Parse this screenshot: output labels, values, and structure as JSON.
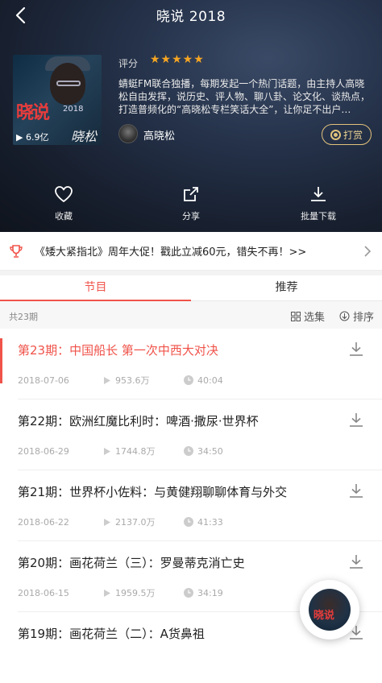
{
  "header": {
    "title": "晓说 2018",
    "cover": {
      "brand": "晓说",
      "year": "2018",
      "plays": "▶ 6.9亿",
      "signature": "晓松"
    },
    "rating_label": "评分",
    "stars": "★★★★★",
    "description": "蜻蜓FM联合独播，每期发起一个热门话题，由主持人高晓松自由发挥，说历史、评人物、聊八卦、论文化、谈热点，打造普频化的“高晓松专栏笑话大全”，让你足不出户…",
    "host_name": "高晓松",
    "reward_label": "打赏",
    "actions": [
      {
        "label": "收藏",
        "icon": "heart-icon"
      },
      {
        "label": "分享",
        "icon": "share-icon"
      },
      {
        "label": "批量下载",
        "icon": "download-icon"
      }
    ]
  },
  "promo": {
    "text": "《矮大紧指北》周年大促！戳此立减60元，错失不再！>>"
  },
  "tabs": [
    {
      "label": "节目",
      "active": true
    },
    {
      "label": "推荐",
      "active": false
    }
  ],
  "list": {
    "count": "共23期",
    "select_label": "选集",
    "sort_label": "排序"
  },
  "episodes": [
    {
      "title": "第23期：中国船长 第一次中西大对决",
      "date": "2018-07-06",
      "plays": "953.6万",
      "duration": "40:04",
      "active": true
    },
    {
      "title": "第22期：欧洲红魔比利时：啤酒·撒尿·世界杯",
      "date": "2018-06-29",
      "plays": "1744.8万",
      "duration": "34:50",
      "active": false
    },
    {
      "title": "第21期：世界杯小佐料：与黄健翔聊聊体育与外交",
      "date": "2018-06-22",
      "plays": "2137.0万",
      "duration": "41:33",
      "active": false
    },
    {
      "title": "第20期：画花荷兰（三）：罗曼蒂克消亡史",
      "date": "2018-06-15",
      "plays": "1959.5万",
      "duration": "34:19",
      "active": false
    },
    {
      "title": "第19期：画花荷兰（二）：A货鼻祖",
      "date": "",
      "plays": "",
      "duration": "",
      "active": false
    }
  ],
  "colors": {
    "accent": "#f0534a",
    "gold": "#e2c27c",
    "header_bg": "#1c2536"
  }
}
